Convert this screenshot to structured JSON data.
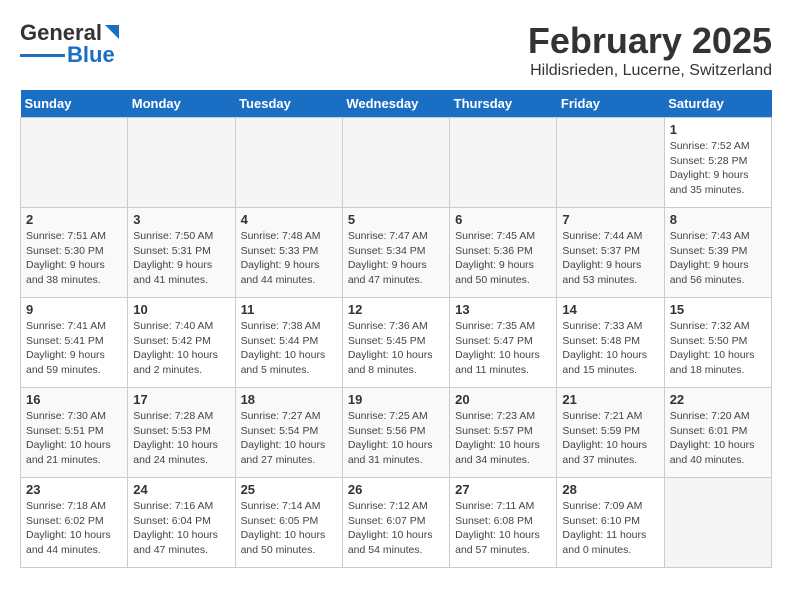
{
  "header": {
    "logo_general": "General",
    "logo_blue": "Blue",
    "month_title": "February 2025",
    "location": "Hildisrieden, Lucerne, Switzerland"
  },
  "days_of_week": [
    "Sunday",
    "Monday",
    "Tuesday",
    "Wednesday",
    "Thursday",
    "Friday",
    "Saturday"
  ],
  "weeks": [
    [
      {
        "num": "",
        "info": ""
      },
      {
        "num": "",
        "info": ""
      },
      {
        "num": "",
        "info": ""
      },
      {
        "num": "",
        "info": ""
      },
      {
        "num": "",
        "info": ""
      },
      {
        "num": "",
        "info": ""
      },
      {
        "num": "1",
        "info": "Sunrise: 7:52 AM\nSunset: 5:28 PM\nDaylight: 9 hours and 35 minutes."
      }
    ],
    [
      {
        "num": "2",
        "info": "Sunrise: 7:51 AM\nSunset: 5:30 PM\nDaylight: 9 hours and 38 minutes."
      },
      {
        "num": "3",
        "info": "Sunrise: 7:50 AM\nSunset: 5:31 PM\nDaylight: 9 hours and 41 minutes."
      },
      {
        "num": "4",
        "info": "Sunrise: 7:48 AM\nSunset: 5:33 PM\nDaylight: 9 hours and 44 minutes."
      },
      {
        "num": "5",
        "info": "Sunrise: 7:47 AM\nSunset: 5:34 PM\nDaylight: 9 hours and 47 minutes."
      },
      {
        "num": "6",
        "info": "Sunrise: 7:45 AM\nSunset: 5:36 PM\nDaylight: 9 hours and 50 minutes."
      },
      {
        "num": "7",
        "info": "Sunrise: 7:44 AM\nSunset: 5:37 PM\nDaylight: 9 hours and 53 minutes."
      },
      {
        "num": "8",
        "info": "Sunrise: 7:43 AM\nSunset: 5:39 PM\nDaylight: 9 hours and 56 minutes."
      }
    ],
    [
      {
        "num": "9",
        "info": "Sunrise: 7:41 AM\nSunset: 5:41 PM\nDaylight: 9 hours and 59 minutes."
      },
      {
        "num": "10",
        "info": "Sunrise: 7:40 AM\nSunset: 5:42 PM\nDaylight: 10 hours and 2 minutes."
      },
      {
        "num": "11",
        "info": "Sunrise: 7:38 AM\nSunset: 5:44 PM\nDaylight: 10 hours and 5 minutes."
      },
      {
        "num": "12",
        "info": "Sunrise: 7:36 AM\nSunset: 5:45 PM\nDaylight: 10 hours and 8 minutes."
      },
      {
        "num": "13",
        "info": "Sunrise: 7:35 AM\nSunset: 5:47 PM\nDaylight: 10 hours and 11 minutes."
      },
      {
        "num": "14",
        "info": "Sunrise: 7:33 AM\nSunset: 5:48 PM\nDaylight: 10 hours and 15 minutes."
      },
      {
        "num": "15",
        "info": "Sunrise: 7:32 AM\nSunset: 5:50 PM\nDaylight: 10 hours and 18 minutes."
      }
    ],
    [
      {
        "num": "16",
        "info": "Sunrise: 7:30 AM\nSunset: 5:51 PM\nDaylight: 10 hours and 21 minutes."
      },
      {
        "num": "17",
        "info": "Sunrise: 7:28 AM\nSunset: 5:53 PM\nDaylight: 10 hours and 24 minutes."
      },
      {
        "num": "18",
        "info": "Sunrise: 7:27 AM\nSunset: 5:54 PM\nDaylight: 10 hours and 27 minutes."
      },
      {
        "num": "19",
        "info": "Sunrise: 7:25 AM\nSunset: 5:56 PM\nDaylight: 10 hours and 31 minutes."
      },
      {
        "num": "20",
        "info": "Sunrise: 7:23 AM\nSunset: 5:57 PM\nDaylight: 10 hours and 34 minutes."
      },
      {
        "num": "21",
        "info": "Sunrise: 7:21 AM\nSunset: 5:59 PM\nDaylight: 10 hours and 37 minutes."
      },
      {
        "num": "22",
        "info": "Sunrise: 7:20 AM\nSunset: 6:01 PM\nDaylight: 10 hours and 40 minutes."
      }
    ],
    [
      {
        "num": "23",
        "info": "Sunrise: 7:18 AM\nSunset: 6:02 PM\nDaylight: 10 hours and 44 minutes."
      },
      {
        "num": "24",
        "info": "Sunrise: 7:16 AM\nSunset: 6:04 PM\nDaylight: 10 hours and 47 minutes."
      },
      {
        "num": "25",
        "info": "Sunrise: 7:14 AM\nSunset: 6:05 PM\nDaylight: 10 hours and 50 minutes."
      },
      {
        "num": "26",
        "info": "Sunrise: 7:12 AM\nSunset: 6:07 PM\nDaylight: 10 hours and 54 minutes."
      },
      {
        "num": "27",
        "info": "Sunrise: 7:11 AM\nSunset: 6:08 PM\nDaylight: 10 hours and 57 minutes."
      },
      {
        "num": "28",
        "info": "Sunrise: 7:09 AM\nSunset: 6:10 PM\nDaylight: 11 hours and 0 minutes."
      },
      {
        "num": "",
        "info": ""
      }
    ]
  ]
}
